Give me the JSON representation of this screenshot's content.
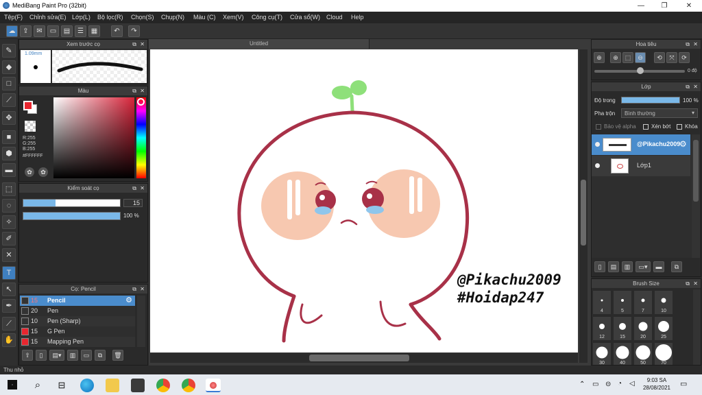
{
  "window": {
    "title": "MediBang Paint Pro (32bit)",
    "minimize": "—",
    "maximize": "❐",
    "close": "✕"
  },
  "menu": [
    "Tệp(F)",
    "Chỉnh sửa(E)",
    "Lớp(L)",
    "Bộ lọc(R)",
    "Chọn(S)",
    "Chụp(N)",
    "Màu (C)",
    "Xem(V)",
    "Công cụ(T)",
    "Cửa sổ(W)",
    "Cloud",
    "Help"
  ],
  "toolbar": {
    "icons": [
      "cloud-icon",
      "share-icon",
      "chat-icon",
      "comment-icon",
      "document-icon",
      "list-icon",
      "grid-icon",
      "undo-icon",
      "redo-icon"
    ]
  },
  "preview_panel": {
    "title": "Xem trước cọ",
    "size": "1.09mm"
  },
  "color_panel": {
    "title": "Màu",
    "r": "R:255",
    "g": "G:255",
    "b": "B:255",
    "hex": "#FFFFFF",
    "primary": "#e8262f",
    "secondary": "#ffffff"
  },
  "brush_control": {
    "title": "Kiểm soát cọ",
    "size": "15",
    "opacity": "100 %",
    "size_fraction": 0.33,
    "opacity_fraction": 1.0
  },
  "brush_panel": {
    "title": "Cọ: Pencil",
    "items": [
      {
        "size": "15",
        "name": "Pencil",
        "color": "#333333",
        "selected": true
      },
      {
        "size": "20",
        "name": "Pen",
        "color": "#333333",
        "selected": false
      },
      {
        "size": "10",
        "name": "Pen (Sharp)",
        "color": "#333333",
        "selected": false
      },
      {
        "size": "15",
        "name": "G Pen",
        "color": "#e8262f",
        "selected": false
      },
      {
        "size": "15",
        "name": "Mapping Pen",
        "color": "#e8262f",
        "selected": false
      }
    ]
  },
  "canvas": {
    "tab": "Untitled",
    "watermark1": "@Pikachu2009",
    "watermark2": "#Hoidap247"
  },
  "navigator": {
    "title": "Hoa tiêu",
    "angle": "0 độ"
  },
  "layer_panel": {
    "title": "Lớp",
    "opacity_label": "Độ trong",
    "opacity": "100 %",
    "opacity_fraction": 1.0,
    "blend_label": "Pha trộn",
    "blend": "Bình thường",
    "protect_alpha": "Bảo vệ alpha",
    "clipping": "Xén bớt",
    "lock": "Khóa",
    "layers": [
      {
        "name": "@Pikachu2009",
        "selected": true
      },
      {
        "name": "Lớp1",
        "selected": false
      }
    ]
  },
  "brush_size": {
    "title": "Brush Size",
    "sizes": [
      "4",
      "5",
      "7",
      "10",
      "12",
      "15",
      "20",
      "25",
      "30",
      "40",
      "50",
      "70"
    ]
  },
  "status": {
    "label": "Thu nhỏ"
  },
  "taskbar": {
    "time": "9:03 SA",
    "date": "28/08/2021"
  }
}
